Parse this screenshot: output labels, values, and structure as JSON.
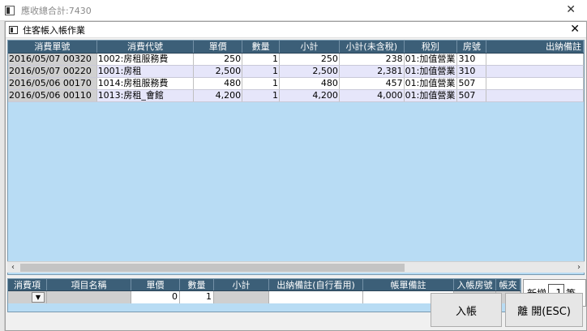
{
  "outer_window": {
    "title": "應收總合計:7430"
  },
  "dialog": {
    "title": "住客帳入帳作業"
  },
  "grid": {
    "headers": [
      "消費單號",
      "消費代號",
      "單價",
      "數量",
      "小計",
      "小計(未含稅)",
      "稅別",
      "房號",
      "出納備註"
    ],
    "rows": [
      {
        "no": "2016/05/07 00320",
        "code": "1002:房租服務費",
        "price": "250",
        "qty": "1",
        "subtotal": "250",
        "pretax": "238",
        "tax": "01:加值營業",
        "room": "310",
        "note": ""
      },
      {
        "no": "2016/05/07 00220",
        "code": "1001:房租",
        "price": "2,500",
        "qty": "1",
        "subtotal": "2,500",
        "pretax": "2,381",
        "tax": "01:加值營業",
        "room": "310",
        "note": ""
      },
      {
        "no": "2016/05/06 00170",
        "code": "1014:房租服務費",
        "price": "480",
        "qty": "1",
        "subtotal": "480",
        "pretax": "457",
        "tax": "01:加值營業",
        "room": "507",
        "note": ""
      },
      {
        "no": "2016/05/06 00110",
        "code": "1013:房租_會館",
        "price": "4,200",
        "qty": "1",
        "subtotal": "4,200",
        "pretax": "4,000",
        "tax": "01:加值營業",
        "room": "507",
        "note": ""
      }
    ]
  },
  "entry": {
    "headers": [
      "消費項",
      "項目名稱",
      "單價",
      "數量",
      "小計",
      "出納備註(自行看用)",
      "帳單備註",
      "入帳房號",
      "帳夾"
    ],
    "values": {
      "item": "",
      "name": "",
      "price": "0",
      "qty": "1",
      "subtotal": "",
      "cashier_note": "",
      "bill_note": "",
      "room": "",
      "folder": "1"
    }
  },
  "add": {
    "label": "新增",
    "count": "1",
    "unit": "筆"
  },
  "buttons": {
    "post": "入帳",
    "leave": "離 開(ESC)"
  }
}
